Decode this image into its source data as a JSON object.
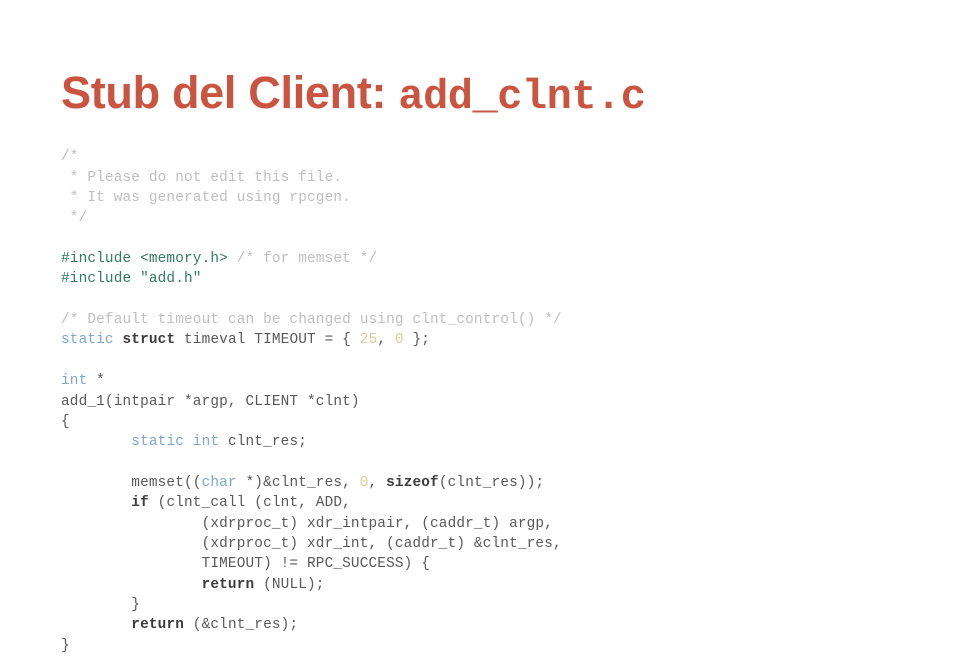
{
  "slide": {
    "title": {
      "prefix": "Stub del Client: ",
      "filename": "add_clnt.c"
    },
    "accent_color": "#cb5440",
    "background_color": "#ffffff",
    "token_colors": {
      "comment": "#bfbfbf",
      "preprocessor": "#2f7d62",
      "keyword": "#7da7d3",
      "keyword_bold": "#3c3c3c",
      "number": "#d6cf96",
      "plain": "#595959"
    },
    "code_lines": [
      {
        "id": "l01",
        "tokens": [
          {
            "t": "/*",
            "c": "comment"
          }
        ]
      },
      {
        "id": "l02",
        "tokens": [
          {
            "t": " * Please do not edit this file.",
            "c": "comment"
          }
        ]
      },
      {
        "id": "l03",
        "tokens": [
          {
            "t": " * It was generated using rpcgen.",
            "c": "comment"
          }
        ]
      },
      {
        "id": "l04",
        "tokens": [
          {
            "t": " */",
            "c": "comment"
          }
        ]
      },
      {
        "id": "l05",
        "tokens": []
      },
      {
        "id": "l06",
        "tokens": [
          {
            "t": "#include <memory.h>",
            "c": "pre"
          },
          {
            "t": " ",
            "c": "plain"
          },
          {
            "t": "/* for memset */",
            "c": "comment"
          }
        ]
      },
      {
        "id": "l07",
        "tokens": [
          {
            "t": "#include \"add.h\"",
            "c": "pre"
          }
        ]
      },
      {
        "id": "l08",
        "tokens": []
      },
      {
        "id": "l09",
        "tokens": [
          {
            "t": "/* Default timeout can be changed using clnt_control() */",
            "c": "comment"
          }
        ]
      },
      {
        "id": "l10",
        "tokens": [
          {
            "t": "static",
            "c": "kw"
          },
          {
            "t": " ",
            "c": "plain"
          },
          {
            "t": "struct",
            "c": "kw-b"
          },
          {
            "t": " timeval TIMEOUT = { ",
            "c": "plain"
          },
          {
            "t": "25",
            "c": "num"
          },
          {
            "t": ", ",
            "c": "plain"
          },
          {
            "t": "0",
            "c": "num"
          },
          {
            "t": " };",
            "c": "plain"
          }
        ]
      },
      {
        "id": "l11",
        "tokens": []
      },
      {
        "id": "l12",
        "tokens": [
          {
            "t": "int",
            "c": "kw"
          },
          {
            "t": " *",
            "c": "plain"
          }
        ]
      },
      {
        "id": "l13",
        "tokens": [
          {
            "t": "add_1(intpair *argp, CLIENT *clnt)",
            "c": "plain"
          }
        ]
      },
      {
        "id": "l14",
        "tokens": [
          {
            "t": "{",
            "c": "plain"
          }
        ]
      },
      {
        "id": "l15",
        "tokens": [
          {
            "t": "        ",
            "c": "plain"
          },
          {
            "t": "static int",
            "c": "kw"
          },
          {
            "t": " clnt_res;",
            "c": "plain"
          }
        ]
      },
      {
        "id": "l16",
        "tokens": []
      },
      {
        "id": "l17",
        "tokens": [
          {
            "t": "        memset((",
            "c": "plain"
          },
          {
            "t": "char",
            "c": "kw"
          },
          {
            "t": " *)&clnt_res, ",
            "c": "plain"
          },
          {
            "t": "0",
            "c": "num"
          },
          {
            "t": ", ",
            "c": "plain"
          },
          {
            "t": "sizeof",
            "c": "bold"
          },
          {
            "t": "(clnt_res));",
            "c": "plain"
          }
        ]
      },
      {
        "id": "l18",
        "tokens": [
          {
            "t": "        ",
            "c": "plain"
          },
          {
            "t": "if",
            "c": "bold"
          },
          {
            "t": " (clnt_call (clnt, ADD,",
            "c": "plain"
          }
        ]
      },
      {
        "id": "l19",
        "tokens": [
          {
            "t": "                (xdrproc_t) xdr_intpair, (caddr_t) argp,",
            "c": "plain"
          }
        ]
      },
      {
        "id": "l20",
        "tokens": [
          {
            "t": "                (xdrproc_t) xdr_int, (caddr_t) &clnt_res,",
            "c": "plain"
          }
        ]
      },
      {
        "id": "l21",
        "tokens": [
          {
            "t": "                TIMEOUT) != RPC_SUCCESS) {",
            "c": "plain"
          }
        ]
      },
      {
        "id": "l22",
        "tokens": [
          {
            "t": "                ",
            "c": "plain"
          },
          {
            "t": "return",
            "c": "bold"
          },
          {
            "t": " (NULL);",
            "c": "plain"
          }
        ]
      },
      {
        "id": "l23",
        "tokens": [
          {
            "t": "        }",
            "c": "plain"
          }
        ]
      },
      {
        "id": "l24",
        "tokens": [
          {
            "t": "        ",
            "c": "plain"
          },
          {
            "t": "return",
            "c": "bold"
          },
          {
            "t": " (&clnt_res);",
            "c": "plain"
          }
        ]
      },
      {
        "id": "l25",
        "tokens": [
          {
            "t": "}",
            "c": "plain"
          }
        ]
      }
    ]
  }
}
